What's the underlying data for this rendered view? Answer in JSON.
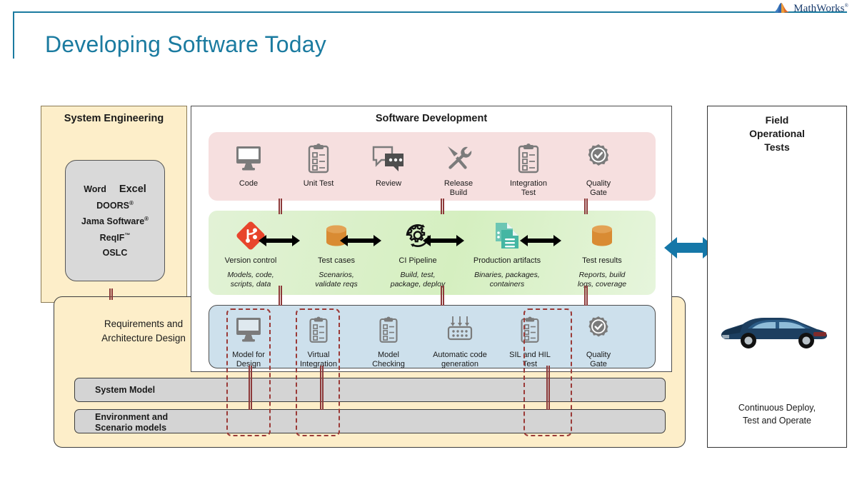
{
  "logo": {
    "name": "MathWorks",
    "tm": "®",
    "icon": "mathworks-membrane-logo"
  },
  "title": "Developing Software Today",
  "system_engineering": {
    "title": "System Engineering",
    "tools": [
      "Word",
      "Excel",
      "DOORS",
      "Jama Software",
      "ReqIF",
      "OSLC"
    ],
    "tool_marks": {
      "doors": "®",
      "jama": "®",
      "reqif": "™"
    }
  },
  "requirements": {
    "label_line1": "Requirements and",
    "label_line2": "Architecture Design",
    "bars": [
      {
        "label": "System Model"
      },
      {
        "label_line1": "Environment and",
        "label_line2": "Scenario models"
      }
    ]
  },
  "software_development": {
    "title": "Software Development",
    "pink_row": [
      {
        "label": "Code",
        "icon": "monitor-icon"
      },
      {
        "label": "Unit Test",
        "icon": "clipboard-checklist-icon"
      },
      {
        "label": "Review",
        "icon": "speech-bubbles-icon"
      },
      {
        "label_line1": "Release",
        "label_line2": "Build",
        "icon": "tools-icon"
      },
      {
        "label_line1": "Integration",
        "label_line2": "Test",
        "icon": "clipboard-checklist-icon"
      },
      {
        "label_line1": "Quality",
        "label_line2": "Gate",
        "icon": "quality-seal-icon"
      }
    ],
    "green_row": [
      {
        "label": "Version control",
        "sub_line1": "Models, code,",
        "sub_line2": "scripts, data",
        "icon": "git-icon"
      },
      {
        "label": "Test cases",
        "sub_line1": "Scenarios,",
        "sub_line2": "validate reqs",
        "icon": "database-icon"
      },
      {
        "label": "CI Pipeline",
        "sub_line1": "Build, test,",
        "sub_line2": "package, deploy",
        "icon": "ci-gear-icon"
      },
      {
        "label": "Production artifacts",
        "sub_line1": "Binaries, packages,",
        "sub_line2": "containers",
        "icon": "documents-icon"
      },
      {
        "label": "Test results",
        "sub_line1": "Reports, build",
        "sub_line2": "logs, coverage",
        "icon": "database-icon"
      }
    ],
    "blue_row": [
      {
        "label_line1": "Model for",
        "label_line2": "Design",
        "icon": "monitor-icon",
        "highlighted": true
      },
      {
        "label_line1": "Virtual",
        "label_line2": "Integration",
        "icon": "clipboard-checklist-icon",
        "highlighted": true
      },
      {
        "label_line1": "Model",
        "label_line2": "Checking",
        "icon": "clipboard-checklist-icon",
        "highlighted": false
      },
      {
        "label_line1": "Automatic code",
        "label_line2": "generation",
        "icon": "code-generation-icon",
        "highlighted": false
      },
      {
        "label_line1": "SIL and HIL",
        "label_line2": "Test",
        "icon": "clipboard-checklist-icon",
        "highlighted": true
      },
      {
        "label_line1": "Quality",
        "label_line2": "Gate",
        "icon": "quality-seal-icon",
        "highlighted": false
      }
    ]
  },
  "field_tests": {
    "title_line1": "Field",
    "title_line2": "Operational",
    "title_line3": "Tests",
    "vehicle_icon": "blue-sedan-car-icon",
    "footer_line1": "Continuous Deploy,",
    "footer_line2": "Test and Operate"
  },
  "colors": {
    "accent": "#1b7ba0",
    "pink_band": "#f6dfdf",
    "green_band": "#d9f0c7",
    "blue_band": "#cde0ec",
    "yellow_panel": "#fdeec9",
    "gray_bar": "#d4d4d4",
    "connector_red": "#8d3a3a",
    "dashed_red": "#9b3a37",
    "git_orange": "#e8452c",
    "database_orange": "#d98b33",
    "artifact_teal": "#5bbfae",
    "icon_gray": "#7b7b7b",
    "car_blue": "#1d3f60"
  }
}
